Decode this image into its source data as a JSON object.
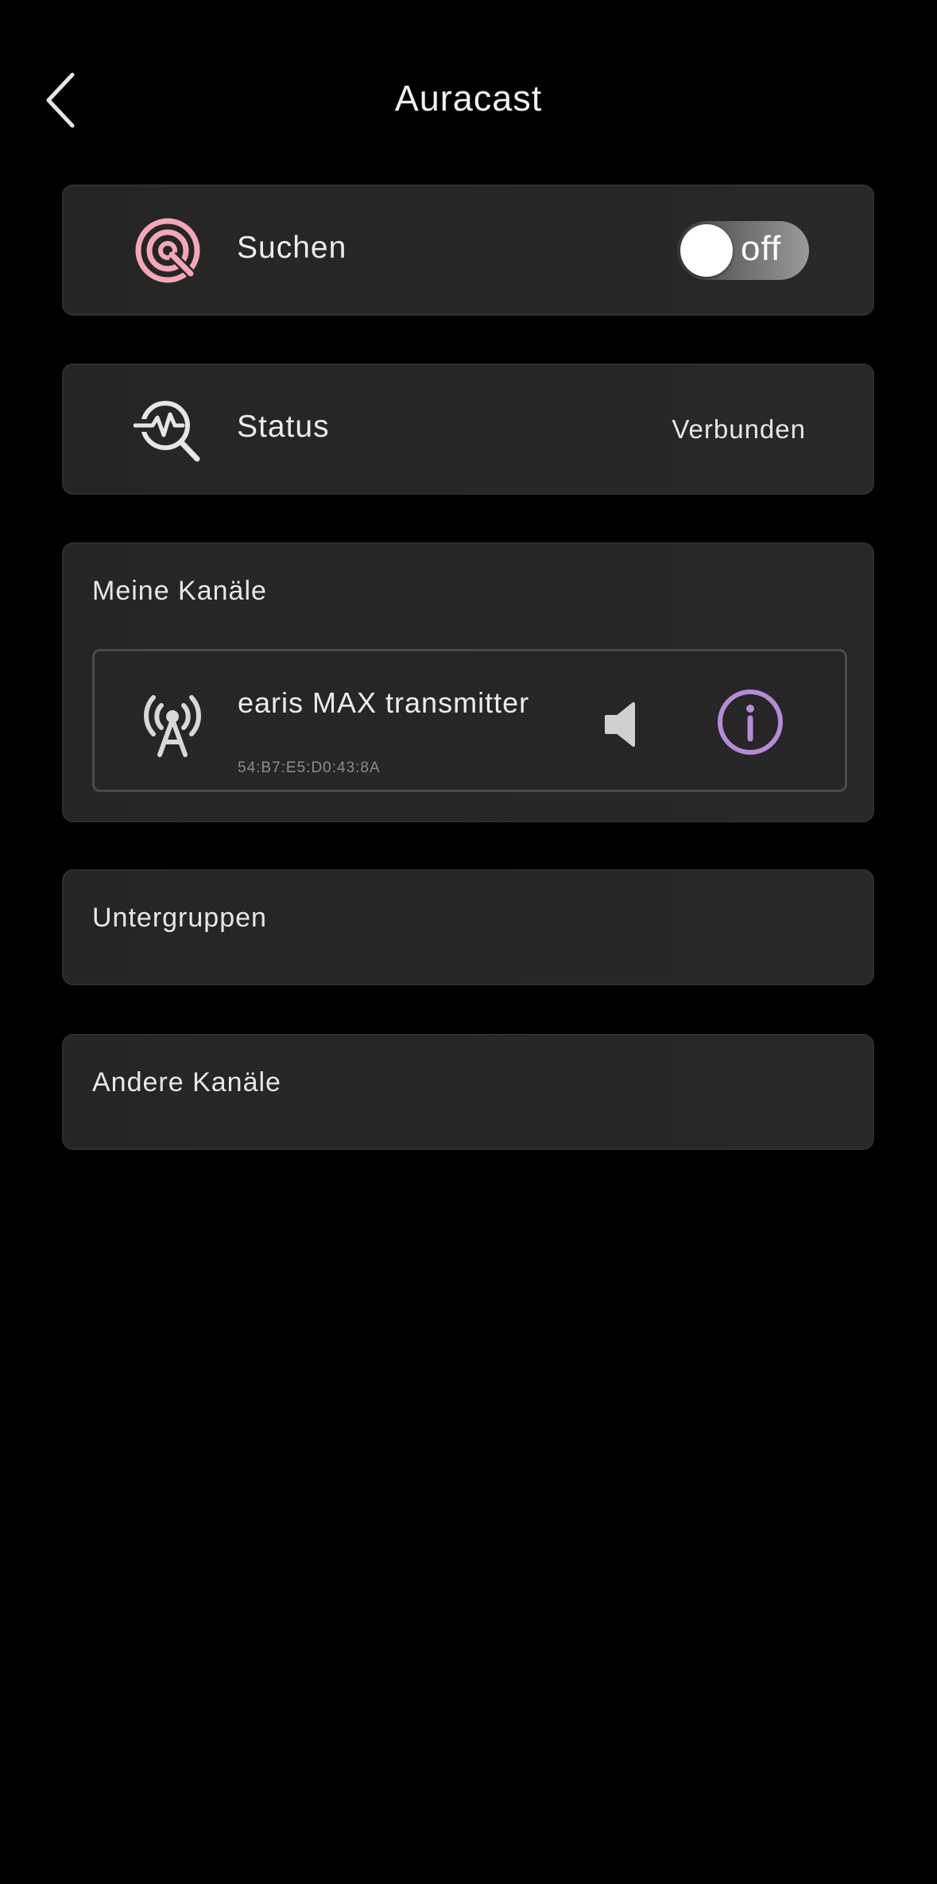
{
  "header": {
    "title": "Auracast"
  },
  "search": {
    "label": "Suchen",
    "toggle_state": "off"
  },
  "status": {
    "label": "Status",
    "value": "Verbunden"
  },
  "my_channels": {
    "title": "Meine Kanäle",
    "items": [
      {
        "name": "earis MAX transmitter",
        "mac": "54:B7:E5:D0:43:8A"
      }
    ]
  },
  "subgroups": {
    "title": "Untergruppen"
  },
  "other_channels": {
    "title": "Andere Kanäle"
  },
  "colors": {
    "background": "#000000",
    "card": "#272727",
    "search_icon": "#f4a7b9",
    "info_icon": "#b68ad6",
    "text": "#ececec"
  }
}
